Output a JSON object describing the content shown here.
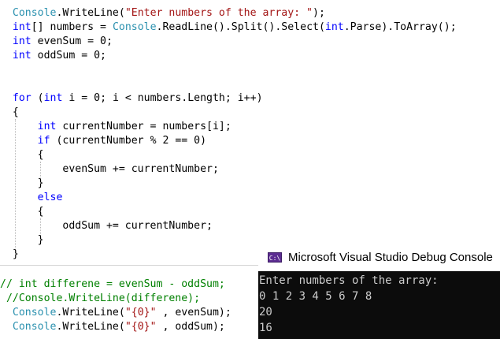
{
  "editor": {
    "lines": [
      [
        {
          "t": "  Console",
          "c": "type"
        },
        {
          "t": ".WriteLine(",
          "c": "tx"
        },
        {
          "t": "\"Enter numbers of the array: \"",
          "c": "str"
        },
        {
          "t": ");",
          "c": "tx"
        }
      ],
      [
        {
          "t": "  ",
          "c": "tx"
        },
        {
          "t": "int",
          "c": "kw"
        },
        {
          "t": "[] numbers = ",
          "c": "tx"
        },
        {
          "t": "Console",
          "c": "type"
        },
        {
          "t": ".ReadLine().Split().Select(",
          "c": "tx"
        },
        {
          "t": "int",
          "c": "kw"
        },
        {
          "t": ".Parse).ToArray();",
          "c": "tx"
        }
      ],
      [
        {
          "t": "  ",
          "c": "tx"
        },
        {
          "t": "int",
          "c": "kw"
        },
        {
          "t": " evenSum = 0;",
          "c": "tx"
        }
      ],
      [
        {
          "t": "  ",
          "c": "tx"
        },
        {
          "t": "int",
          "c": "kw"
        },
        {
          "t": " oddSum = 0;",
          "c": "tx"
        }
      ],
      [],
      [],
      [
        {
          "t": "  ",
          "c": "tx"
        },
        {
          "t": "for",
          "c": "kw"
        },
        {
          "t": " (",
          "c": "tx"
        },
        {
          "t": "int",
          "c": "kw"
        },
        {
          "t": " i = 0; i < numbers.Length; i++)",
          "c": "tx"
        }
      ],
      [
        {
          "t": "  {",
          "c": "tx"
        }
      ],
      [
        {
          "t": "      ",
          "c": "tx"
        },
        {
          "t": "int",
          "c": "kw"
        },
        {
          "t": " currentNumber = numbers[i];",
          "c": "tx"
        }
      ],
      [
        {
          "t": "      ",
          "c": "tx"
        },
        {
          "t": "if",
          "c": "kw"
        },
        {
          "t": " (currentNumber % 2 == 0)",
          "c": "tx"
        }
      ],
      [
        {
          "t": "      {",
          "c": "tx"
        }
      ],
      [
        {
          "t": "          evenSum += currentNumber;",
          "c": "tx"
        }
      ],
      [
        {
          "t": "      }",
          "c": "tx"
        }
      ],
      [
        {
          "t": "      ",
          "c": "tx"
        },
        {
          "t": "else",
          "c": "kw"
        }
      ],
      [
        {
          "t": "      {",
          "c": "tx"
        }
      ],
      [
        {
          "t": "          oddSum += currentNumber;",
          "c": "tx"
        }
      ],
      [
        {
          "t": "      }",
          "c": "tx"
        }
      ],
      [
        {
          "t": "  }",
          "c": "tx"
        }
      ],
      [],
      [
        {
          "t": "// int differene = evenSum - oddSum;",
          "c": "cm"
        }
      ],
      [
        {
          "t": " //Console.WriteLine(differene);",
          "c": "cm"
        }
      ],
      [
        {
          "t": "  Console",
          "c": "type"
        },
        {
          "t": ".WriteLine(",
          "c": "tx"
        },
        {
          "t": "\"{0}\"",
          "c": "str"
        },
        {
          "t": " , evenSum);",
          "c": "tx"
        }
      ],
      [
        {
          "t": "  Console",
          "c": "type"
        },
        {
          "t": ".WriteLine(",
          "c": "tx"
        },
        {
          "t": "\"{0}\"",
          "c": "str"
        },
        {
          "t": " , oddSum);",
          "c": "tx"
        }
      ]
    ]
  },
  "debug_console": {
    "icon_label": "C:\\",
    "title": "Microsoft Visual Studio Debug Console",
    "output": [
      "Enter numbers of the array:",
      "0 1 2 3 4 5 6 7 8",
      "20",
      "16"
    ]
  },
  "colors": {
    "keyword": "#0000ff",
    "type": "#2b91af",
    "string": "#a31515",
    "comment": "#008000",
    "console_bg": "#0c0c0c",
    "console_text": "#cccccc"
  }
}
